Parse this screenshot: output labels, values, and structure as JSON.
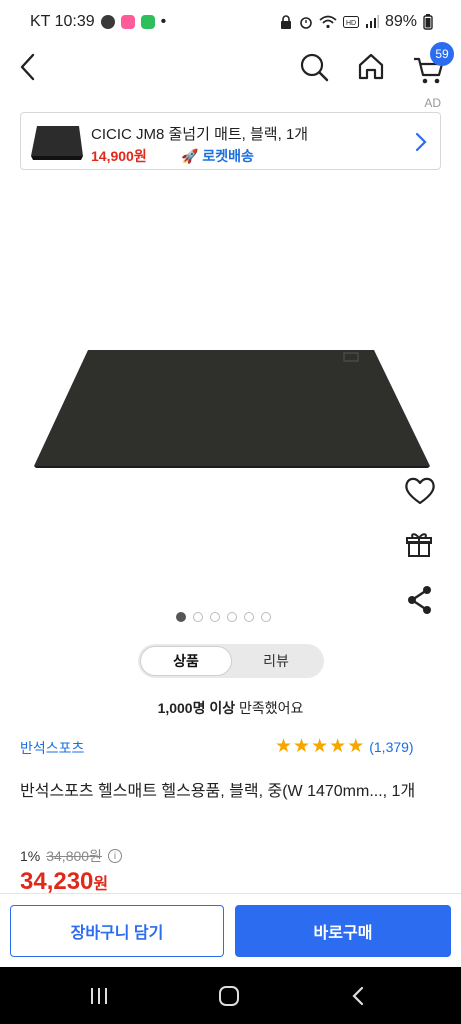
{
  "status_bar": {
    "carrier_time": "KT 10:39",
    "dot": "•",
    "battery": "89%"
  },
  "app_bar": {
    "cart_badge": "59"
  },
  "ad": {
    "label": "AD",
    "title": "CICIC JM8 줄넘기 매트, 블랙, 1개",
    "price": "14,900원",
    "rocket": "🚀 로켓배송"
  },
  "gallery": {
    "slide_count": 6,
    "active_index": 0
  },
  "toggle": {
    "tab_product": "상품",
    "tab_review": "리뷰"
  },
  "satisfaction": {
    "bold": "1,000명 이상",
    "rest": " 만족했어요"
  },
  "product": {
    "brand": "반석스포츠",
    "rating_stars": 5,
    "review_count": "(1,379)",
    "title": "반석스포츠 헬스매트 헬스용품, 블랙, 중(W 1470mm..., 1개",
    "discount": "1%",
    "original_price": "34,800원",
    "price": "34,230",
    "price_unit": "원"
  },
  "actions": {
    "cart": "장바구니 담기",
    "buy": "바로구매"
  },
  "colors": {
    "accent": "#2b6cf0",
    "price_red": "#e0291a",
    "star": "#f7a600"
  }
}
